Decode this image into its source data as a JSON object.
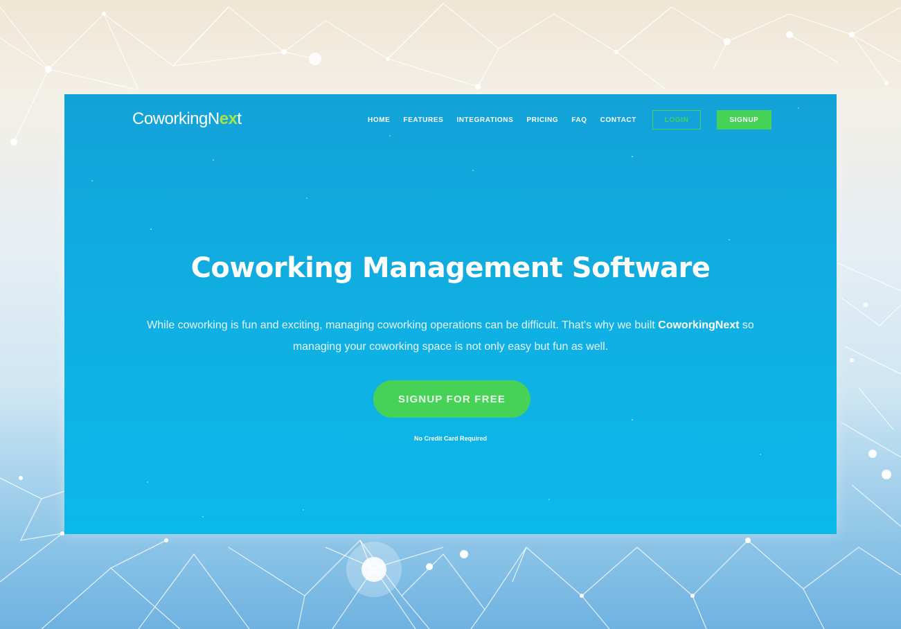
{
  "brand": {
    "name_prefix": "CoworkingN",
    "name_accent": "ex",
    "name_suffix": "t"
  },
  "nav": {
    "items": [
      {
        "label": "HOME"
      },
      {
        "label": "FEATURES"
      },
      {
        "label": "INTEGRATIONS"
      },
      {
        "label": "PRICING"
      },
      {
        "label": "FAQ"
      },
      {
        "label": "CONTACT"
      }
    ],
    "login_label": "LOGIN",
    "signup_label": "SIGNUP"
  },
  "hero": {
    "title": "Coworking Management Software",
    "desc_part1": "While coworking is fun and exciting, managing coworking operations can be difficult. That's why we built ",
    "desc_brand": "CoworkingNext",
    "desc_part2": " so managing your coworking space is not only easy but fun as well.",
    "cta_label": "SIGNUP FOR FREE",
    "note": "No Credit Card Required"
  },
  "colors": {
    "accent_green": "#46d157",
    "hero_blue": "#0fb0e3",
    "logo_accent": "#a7e34a"
  }
}
